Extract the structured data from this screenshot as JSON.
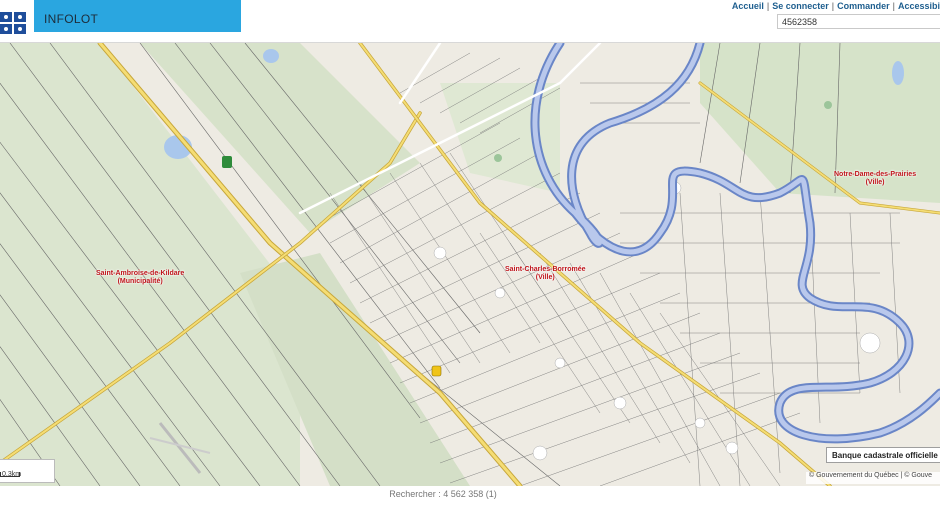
{
  "header": {
    "app_title": "INFOLOT",
    "nav": [
      "Accueil",
      "Se connecter",
      "Commander",
      "Accessibi"
    ],
    "search_value": "4562358"
  },
  "map": {
    "labels": {
      "saint_ambroise": [
        "Saint-Ambroise-de-Kildare",
        "(Municipalité)"
      ],
      "saint_charles": [
        "Saint-Charles-Borromée",
        "(Ville)"
      ],
      "notre_dame": [
        "Notre-Dame-des-Prairies",
        "(Ville)"
      ]
    },
    "scale_label": "0.3km",
    "cadastre_label": "Banque cadastrale officielle en",
    "copyright": "© Gouvernement du Québec | © Gouve"
  },
  "status": {
    "search_result": "Rechercher : 4 562 358 (1)"
  }
}
